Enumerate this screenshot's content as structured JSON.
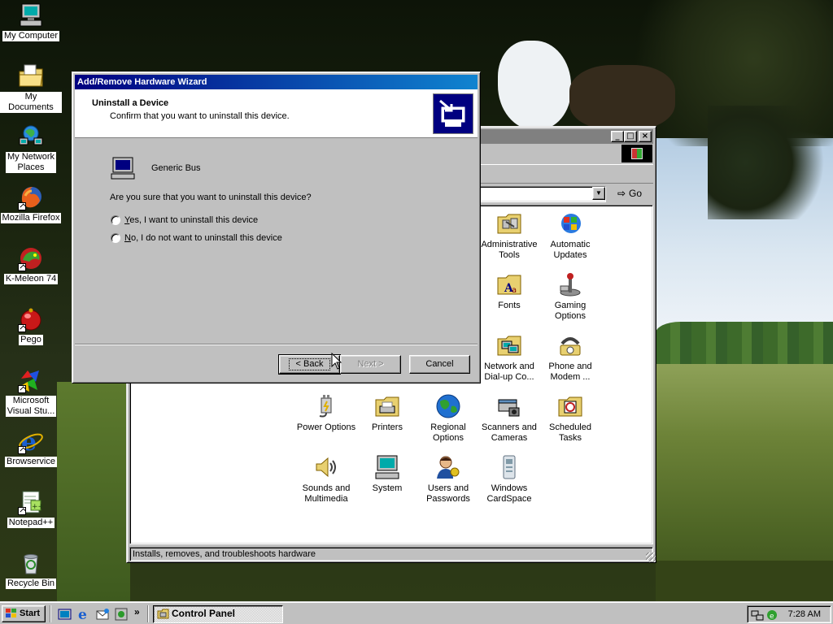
{
  "desktop": {
    "icons": [
      {
        "label": "My Computer",
        "icon": "my-computer-icon"
      },
      {
        "label": "My Documents",
        "icon": "my-documents-icon"
      },
      {
        "label_line1": "My Network",
        "label_line2": "Places",
        "icon": "network-places-icon"
      },
      {
        "label": "Mozilla Firefox",
        "icon": "firefox-icon"
      },
      {
        "label": "K-Meleon 74",
        "icon": "k-meleon-icon"
      },
      {
        "label": "Pego",
        "icon": "pego-icon"
      },
      {
        "label_line1": "Microsoft",
        "label_line2": "Visual Stu...",
        "icon": "visual-studio-icon"
      },
      {
        "label": "Browservice",
        "icon": "internet-explorer-icon"
      },
      {
        "label": "Notepad++",
        "icon": "notepad-plus-plus-icon"
      },
      {
        "label": "Recycle Bin",
        "icon": "recycle-bin-icon"
      }
    ]
  },
  "control_panel": {
    "go_label": "Go",
    "status_text": "Installs, removes, and troubleshoots hardware",
    "items": [
      {
        "line1": "Administrative",
        "line2": "Tools",
        "icon": "administrative-tools-icon"
      },
      {
        "line1": "Automatic",
        "line2": "Updates",
        "icon": "automatic-updates-icon"
      },
      {
        "line1": "Fonts",
        "line2": "",
        "icon": "fonts-icon"
      },
      {
        "line1": "Gaming",
        "line2": "Options",
        "icon": "gaming-options-icon"
      },
      {
        "line1": "Network and",
        "line2": "Dial-up Co...",
        "icon": "network-dialup-icon"
      },
      {
        "line1": "Phone and",
        "line2": "Modem ...",
        "icon": "phone-modem-icon"
      },
      {
        "line1": "Power Options",
        "line2": "",
        "icon": "power-options-icon"
      },
      {
        "line1": "Printers",
        "line2": "",
        "icon": "printers-icon"
      },
      {
        "line1": "Regional",
        "line2": "Options",
        "icon": "regional-options-icon"
      },
      {
        "line1": "Scanners and",
        "line2": "Cameras",
        "icon": "scanners-cameras-icon"
      },
      {
        "line1": "Scheduled",
        "line2": "Tasks",
        "icon": "scheduled-tasks-icon"
      },
      {
        "line1": "Sounds and",
        "line2": "Multimedia",
        "icon": "sounds-multimedia-icon"
      },
      {
        "line1": "System",
        "line2": "",
        "icon": "system-icon"
      },
      {
        "line1": "Users and",
        "line2": "Passwords",
        "icon": "users-passwords-icon"
      },
      {
        "line1": "Windows",
        "line2": "CardSpace",
        "icon": "windows-cardspace-icon"
      }
    ]
  },
  "wizard": {
    "title": "Add/Remove Hardware Wizard",
    "header_title": "Uninstall a Device",
    "header_subtitle": "Confirm that you want to uninstall this device.",
    "device_name": "Generic Bus",
    "question": "Are you sure that you want to uninstall this device?",
    "option_yes_key": "Y",
    "option_yes_rest": "es, I want to uninstall this device",
    "option_no_key": "N",
    "option_no_rest": "o, I do not want to uninstall this device",
    "back_label": "< Back",
    "next_label": "Next >",
    "cancel_label": "Cancel"
  },
  "taskbar": {
    "start_label": "Start",
    "task_label": "Control Panel",
    "clock": "7:28 AM",
    "chevron": "»"
  }
}
